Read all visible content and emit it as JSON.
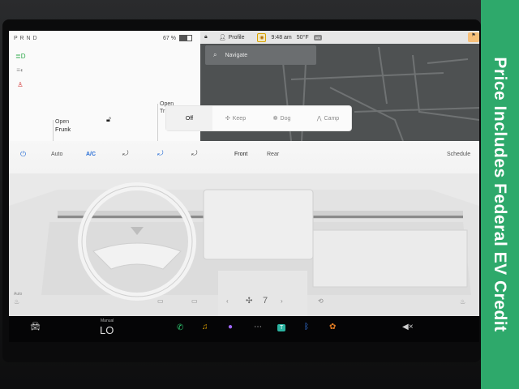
{
  "banner": {
    "text": "Price Includes Federal EV Credit"
  },
  "status": {
    "gear": "P R N D",
    "battery_pct": "67 %",
    "battery_level": 0.67
  },
  "top_bar": {
    "profile_label": "Profile",
    "time": "9:48 am",
    "temperature": "50°F",
    "airbag_chip": "ABI"
  },
  "navigate": {
    "placeholder": "Navigate"
  },
  "frunk": {
    "open_label": "Open",
    "name": "Frunk"
  },
  "trunk": {
    "open_label": "Open",
    "name": "Tr"
  },
  "climate_keeper": {
    "options": [
      "Off",
      "Keep",
      "Dog",
      "Camp"
    ],
    "selected": "Off"
  },
  "climate": {
    "auto_label": "Auto",
    "ac_label": "A/C",
    "front_label": "Front",
    "rear_label": "Rear",
    "schedule_label": "Schedule",
    "fan_speed": "7"
  },
  "dock": {
    "manual_label": "Manual",
    "temp_lo": "LO",
    "volume_icon": "mute",
    "tile_badge": "T"
  },
  "colors": {
    "banner": "#2ea96b",
    "accent_blue": "#2a6fd6",
    "map": "#4e5152"
  }
}
